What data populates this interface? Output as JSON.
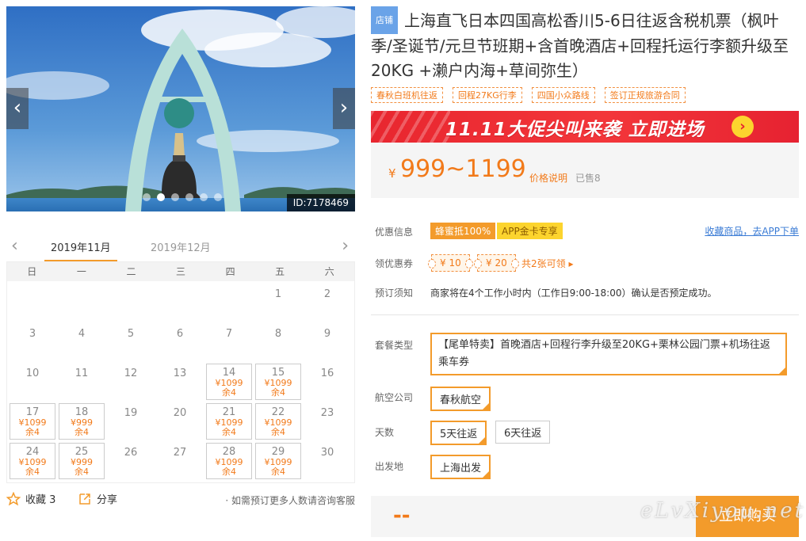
{
  "gallery": {
    "product_id": "ID:7178469",
    "dot_count": 6,
    "active_dot": 1,
    "prev_icon": "‹",
    "next_icon": "›"
  },
  "calendar": {
    "months": [
      "2019年11月",
      "2019年12月"
    ],
    "weekdays": [
      "日",
      "一",
      "二",
      "三",
      "四",
      "五",
      "六"
    ],
    "first_weekday": 5,
    "days_in_month": 30,
    "availability": {
      "14": {
        "price": "¥1099",
        "stock": "余4"
      },
      "15": {
        "price": "¥1099",
        "stock": "余4"
      },
      "17": {
        "price": "¥1099",
        "stock": "余4"
      },
      "18": {
        "price": "¥999",
        "stock": "余4"
      },
      "21": {
        "price": "¥1099",
        "stock": "余4"
      },
      "22": {
        "price": "¥1099",
        "stock": "余4"
      },
      "24": {
        "price": "¥1099",
        "stock": "余4"
      },
      "25": {
        "price": "¥999",
        "stock": "余4"
      },
      "28": {
        "price": "¥1099",
        "stock": "余4"
      },
      "29": {
        "price": "¥1099",
        "stock": "余4"
      }
    }
  },
  "left_footer": {
    "favorite_label": "收藏 3",
    "share_label": "分享",
    "note": "· 如需预订更多人数请咨询客服"
  },
  "product": {
    "shop_tag": "店铺",
    "title": "上海直飞日本四国高松香川5-6日往返含税机票（枫叶季/圣诞节/元旦节班期+含首晚酒店+回程托运行李额升级至20KG +濑户内海+草间弥生）",
    "tags": [
      "春秋白班机往返",
      "回程27KG行李",
      "四国小众路线",
      "签订正规旅游合同"
    ]
  },
  "banner": {
    "text": "11.11大促尖叫来袭 立即进场",
    "go_icon": "›"
  },
  "price": {
    "currency": "¥",
    "range": "999~1199",
    "explain_label": "价格说明",
    "sold": "已售8"
  },
  "discount": {
    "label": "优惠信息",
    "honey_badge": "蜂蜜抵100%",
    "app_badge": "APP金卡专享",
    "favorite_link": "收藏商品，去APP下单"
  },
  "coupons": {
    "label": "领优惠券",
    "items": [
      "¥ 10",
      "¥ 20"
    ],
    "more": "共2张可领 ▸"
  },
  "booking_notice": {
    "label": "预订须知",
    "text": "商家将在4个工作小时内（工作日9:00-18:00）确认是否预定成功。"
  },
  "options": {
    "package": {
      "label": "套餐类型",
      "value": "【尾单特卖】首晚酒店+回程行李升级至20KG+栗林公园门票+机场往返乘车券"
    },
    "airline": {
      "label": "航空公司",
      "value": "春秋航空"
    },
    "days": {
      "label": "天数",
      "values": [
        "5天往返",
        "6天往返"
      ],
      "selected": 0
    },
    "departure": {
      "label": "出发地",
      "value": "上海出发"
    }
  },
  "buy": {
    "price": "--",
    "button": "立即购买"
  },
  "watermark": "eLvXiyou.net"
}
